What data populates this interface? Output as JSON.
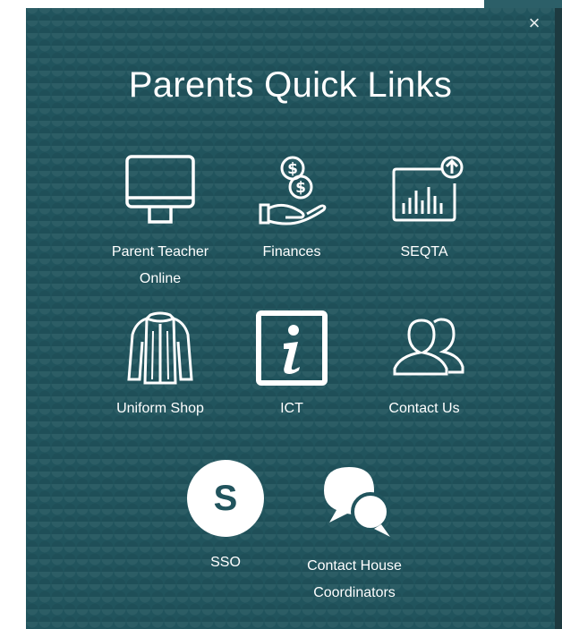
{
  "modal": {
    "title": "Parents Quick Links",
    "close_label": "×"
  },
  "links": [
    {
      "label": "Parent Teacher Online",
      "icon": "monitor-icon"
    },
    {
      "label": "Finances",
      "icon": "money-hand-icon"
    },
    {
      "label": "SEQTA",
      "icon": "chart-screen-icon"
    },
    {
      "label": "Uniform Shop",
      "icon": "jacket-icon"
    },
    {
      "label": "ICT",
      "icon": "info-icon"
    },
    {
      "label": "Contact Us",
      "icon": "users-icon"
    },
    {
      "label": "SSO",
      "icon": "s-circle-icon",
      "icon_text": "S"
    },
    {
      "label": "Contact House Coordinators",
      "icon": "chat-bubbles-icon"
    }
  ],
  "colors": {
    "modal_bg": "#21545d",
    "icon": "#ffffff"
  }
}
